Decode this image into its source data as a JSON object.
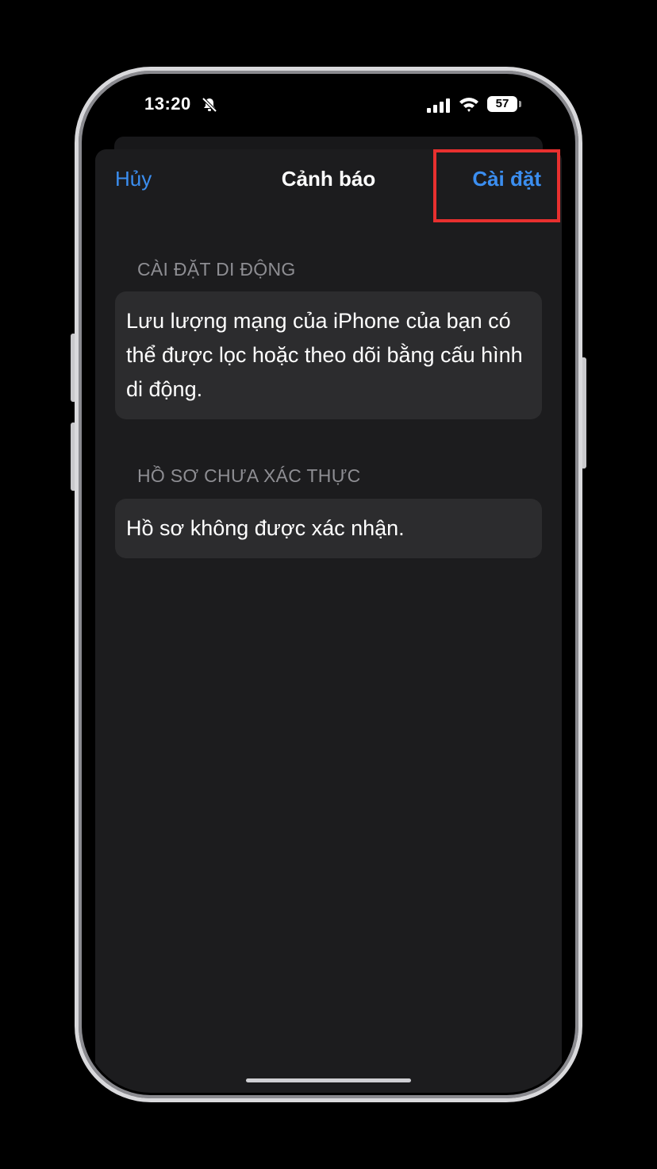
{
  "status_bar": {
    "time": "13:20",
    "battery": "57",
    "icons": [
      "bell-slash-icon",
      "signal-icon",
      "wifi-icon",
      "battery-icon"
    ]
  },
  "nav": {
    "cancel_label": "Hủy",
    "title": "Cảnh báo",
    "install_label": "Cài đặt"
  },
  "sections": [
    {
      "header": "CÀI ĐẶT DI ĐỘNG",
      "body": "Lưu lượng mạng của iPhone của bạn có thể được lọc hoặc theo dõi bằng cấu hình di động."
    },
    {
      "header": "HỒ SƠ CHƯA XÁC THỰC",
      "body": "Hồ sơ không được xác nhận."
    }
  ],
  "colors": {
    "accent": "#3b8ef0",
    "highlight": "#e8302f",
    "sheet_bg": "#1c1c1e",
    "card_bg": "#2c2c2e"
  }
}
